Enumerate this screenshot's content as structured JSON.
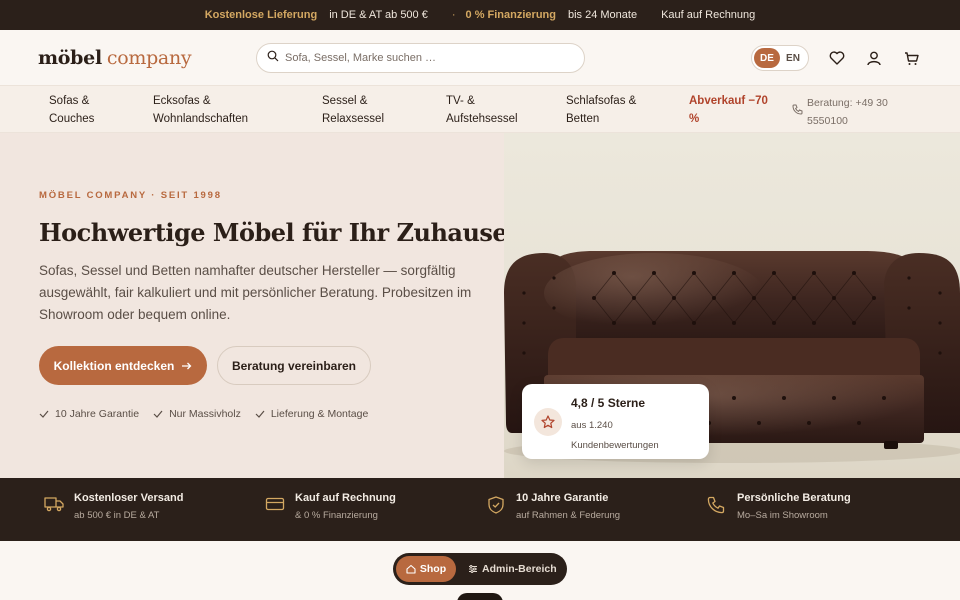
{
  "topbar": {
    "shipping_bold": "Kostenlose Lieferung",
    "shipping_text": "in DE & AT ab 500 €",
    "finance_bold": "0 % Finanzierung",
    "finance_text": "bis 24 Monate",
    "invoice": "Kauf auf Rechnung"
  },
  "header": {
    "logo_main": "möbel",
    "logo_accent": "company",
    "search_placeholder": "Sofa, Sessel, Marke suchen …",
    "lang_de": "DE",
    "lang_en": "EN"
  },
  "nav": {
    "items": [
      {
        "line1": "Sofas &",
        "line2": "Couches"
      },
      {
        "line1": "Ecksofas &",
        "line2": "Wohnlandschaften"
      },
      {
        "line1": "Sessel &",
        "line2": "Relaxsessel"
      },
      {
        "line1": "TV- &",
        "line2": "Aufstehsessel"
      },
      {
        "line1": "Schlafsofas &",
        "line2": "Betten"
      }
    ],
    "sale_line1": "Abverkauf −70",
    "sale_line2": "%",
    "phone_line1": "Beratung: +49 30",
    "phone_line2": "5550100"
  },
  "hero": {
    "eyebrow": "MÖBEL COMPANY · SEIT 1998",
    "title": "Hochwertige Möbel für Ihr Zuhause.",
    "lead": "Sofas, Sessel und Betten namhafter deutscher Hersteller — sorgfältig ausgewählt, fair kalkuliert und mit persönlicher Beratung. Probesitzen im Showroom oder bequem online.",
    "cta_primary": "Kollektion entdecken",
    "cta_secondary": "Beratung vereinbaren",
    "checks": [
      "10 Jahre Garantie",
      "Nur Massivholz",
      "Lieferung & Montage"
    ]
  },
  "rating": {
    "score": "4,8 / 5 Sterne",
    "detail": "aus 1.240 Kundenbewertungen"
  },
  "benefits": [
    {
      "title": "Kostenloser Versand",
      "sub": "ab 500 € in DE & AT",
      "icon": "truck-icon"
    },
    {
      "title": "Kauf auf Rechnung",
      "sub": "& 0 % Finanzierung",
      "icon": "card-icon"
    },
    {
      "title": "10 Jahre Garantie",
      "sub": "auf Rahmen & Federung",
      "icon": "shield-icon"
    },
    {
      "title": "Persönliche Beratung",
      "sub": "Mo–Sa im Showroom",
      "icon": "phone-icon"
    }
  ],
  "switcher": {
    "shop": "Shop",
    "admin": "Admin-Bereich"
  },
  "colors": {
    "accent": "#b8693f",
    "dark": "#2b201a",
    "gold": "#d4a862",
    "sale": "#b0432b"
  }
}
